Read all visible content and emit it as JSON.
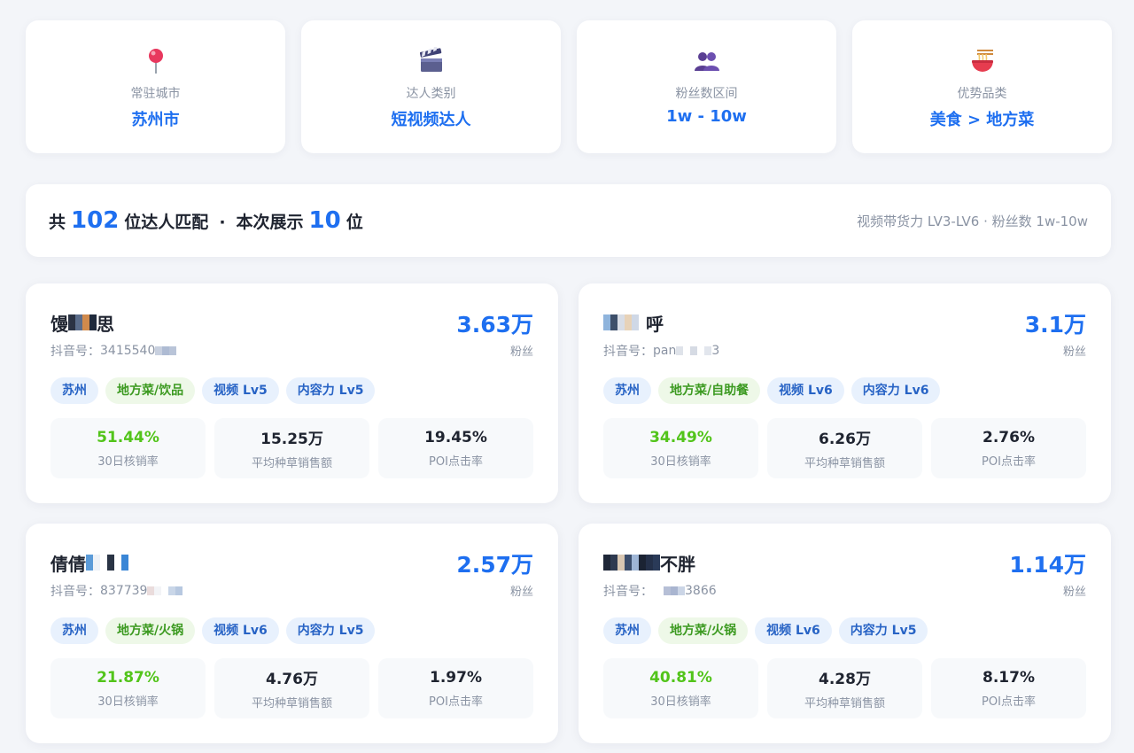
{
  "filters": [
    {
      "icon": "pushpin-icon",
      "label": "常驻城市",
      "value": "苏州市"
    },
    {
      "icon": "clapperboard-icon",
      "label": "达人类别",
      "value": "短视频达人"
    },
    {
      "icon": "people-icon",
      "label": "粉丝数区间",
      "value": "1w - 10w"
    },
    {
      "icon": "noodle-bowl-icon",
      "label": "优势品类",
      "value": "美食 > 地方菜"
    }
  ],
  "summary": {
    "prefix": "共",
    "total": "102",
    "mid": "位达人匹配",
    "dot": "·",
    "shown_prefix": "本次展示",
    "shown": "10",
    "suffix": "位",
    "criteria": "视频带货力 LV3-LV6 · 粉丝数 1w-10w"
  },
  "creators": [
    {
      "name_start": "馒",
      "name_end": "思",
      "handle_label": "抖音号：",
      "handle_visible": "3415540",
      "fans": "3.63万",
      "fans_label": "粉丝",
      "tags": [
        "苏州",
        "地方菜/饮品",
        "视频 Lv5",
        "内容力 Lv5"
      ],
      "metrics": [
        {
          "value": "51.44%",
          "label": "30日核销率"
        },
        {
          "value": "15.25万",
          "label": "平均种草销售额"
        },
        {
          "value": "19.45%",
          "label": "POI点击率"
        }
      ]
    },
    {
      "name_start": "",
      "name_end": "呼",
      "handle_label": "抖音号：",
      "handle_visible": "pan",
      "handle_tail": "3",
      "fans": "3.1万",
      "fans_label": "粉丝",
      "tags": [
        "苏州",
        "地方菜/自助餐",
        "视频 Lv6",
        "内容力 Lv6"
      ],
      "metrics": [
        {
          "value": "34.49%",
          "label": "30日核销率"
        },
        {
          "value": "6.26万",
          "label": "平均种草销售额"
        },
        {
          "value": "2.76%",
          "label": "POI点击率"
        }
      ]
    },
    {
      "name_start": "倩倩",
      "name_end": "",
      "handle_label": "抖音号：",
      "handle_visible": "837739",
      "fans": "2.57万",
      "fans_label": "粉丝",
      "tags": [
        "苏州",
        "地方菜/火锅",
        "视频 Lv6",
        "内容力 Lv5"
      ],
      "metrics": [
        {
          "value": "21.87%",
          "label": "30日核销率"
        },
        {
          "value": "4.76万",
          "label": "平均种草销售额"
        },
        {
          "value": "1.97%",
          "label": "POI点击率"
        }
      ]
    },
    {
      "name_start": "",
      "name_end": "不胖",
      "handle_label": "抖音号：",
      "handle_visible": "",
      "handle_tail": "3866",
      "fans": "1.14万",
      "fans_label": "粉丝",
      "tags": [
        "苏州",
        "地方菜/火锅",
        "视频 Lv6",
        "内容力 Lv5"
      ],
      "metrics": [
        {
          "value": "40.81%",
          "label": "30日核销率"
        },
        {
          "value": "4.28万",
          "label": "平均种草销售额"
        },
        {
          "value": "8.17%",
          "label": "POI点击率"
        }
      ]
    }
  ],
  "colors": {
    "accent": "#1e6ff0",
    "success": "#52c41a",
    "muted": "#8a93a3",
    "background": "#f3f5f9"
  }
}
